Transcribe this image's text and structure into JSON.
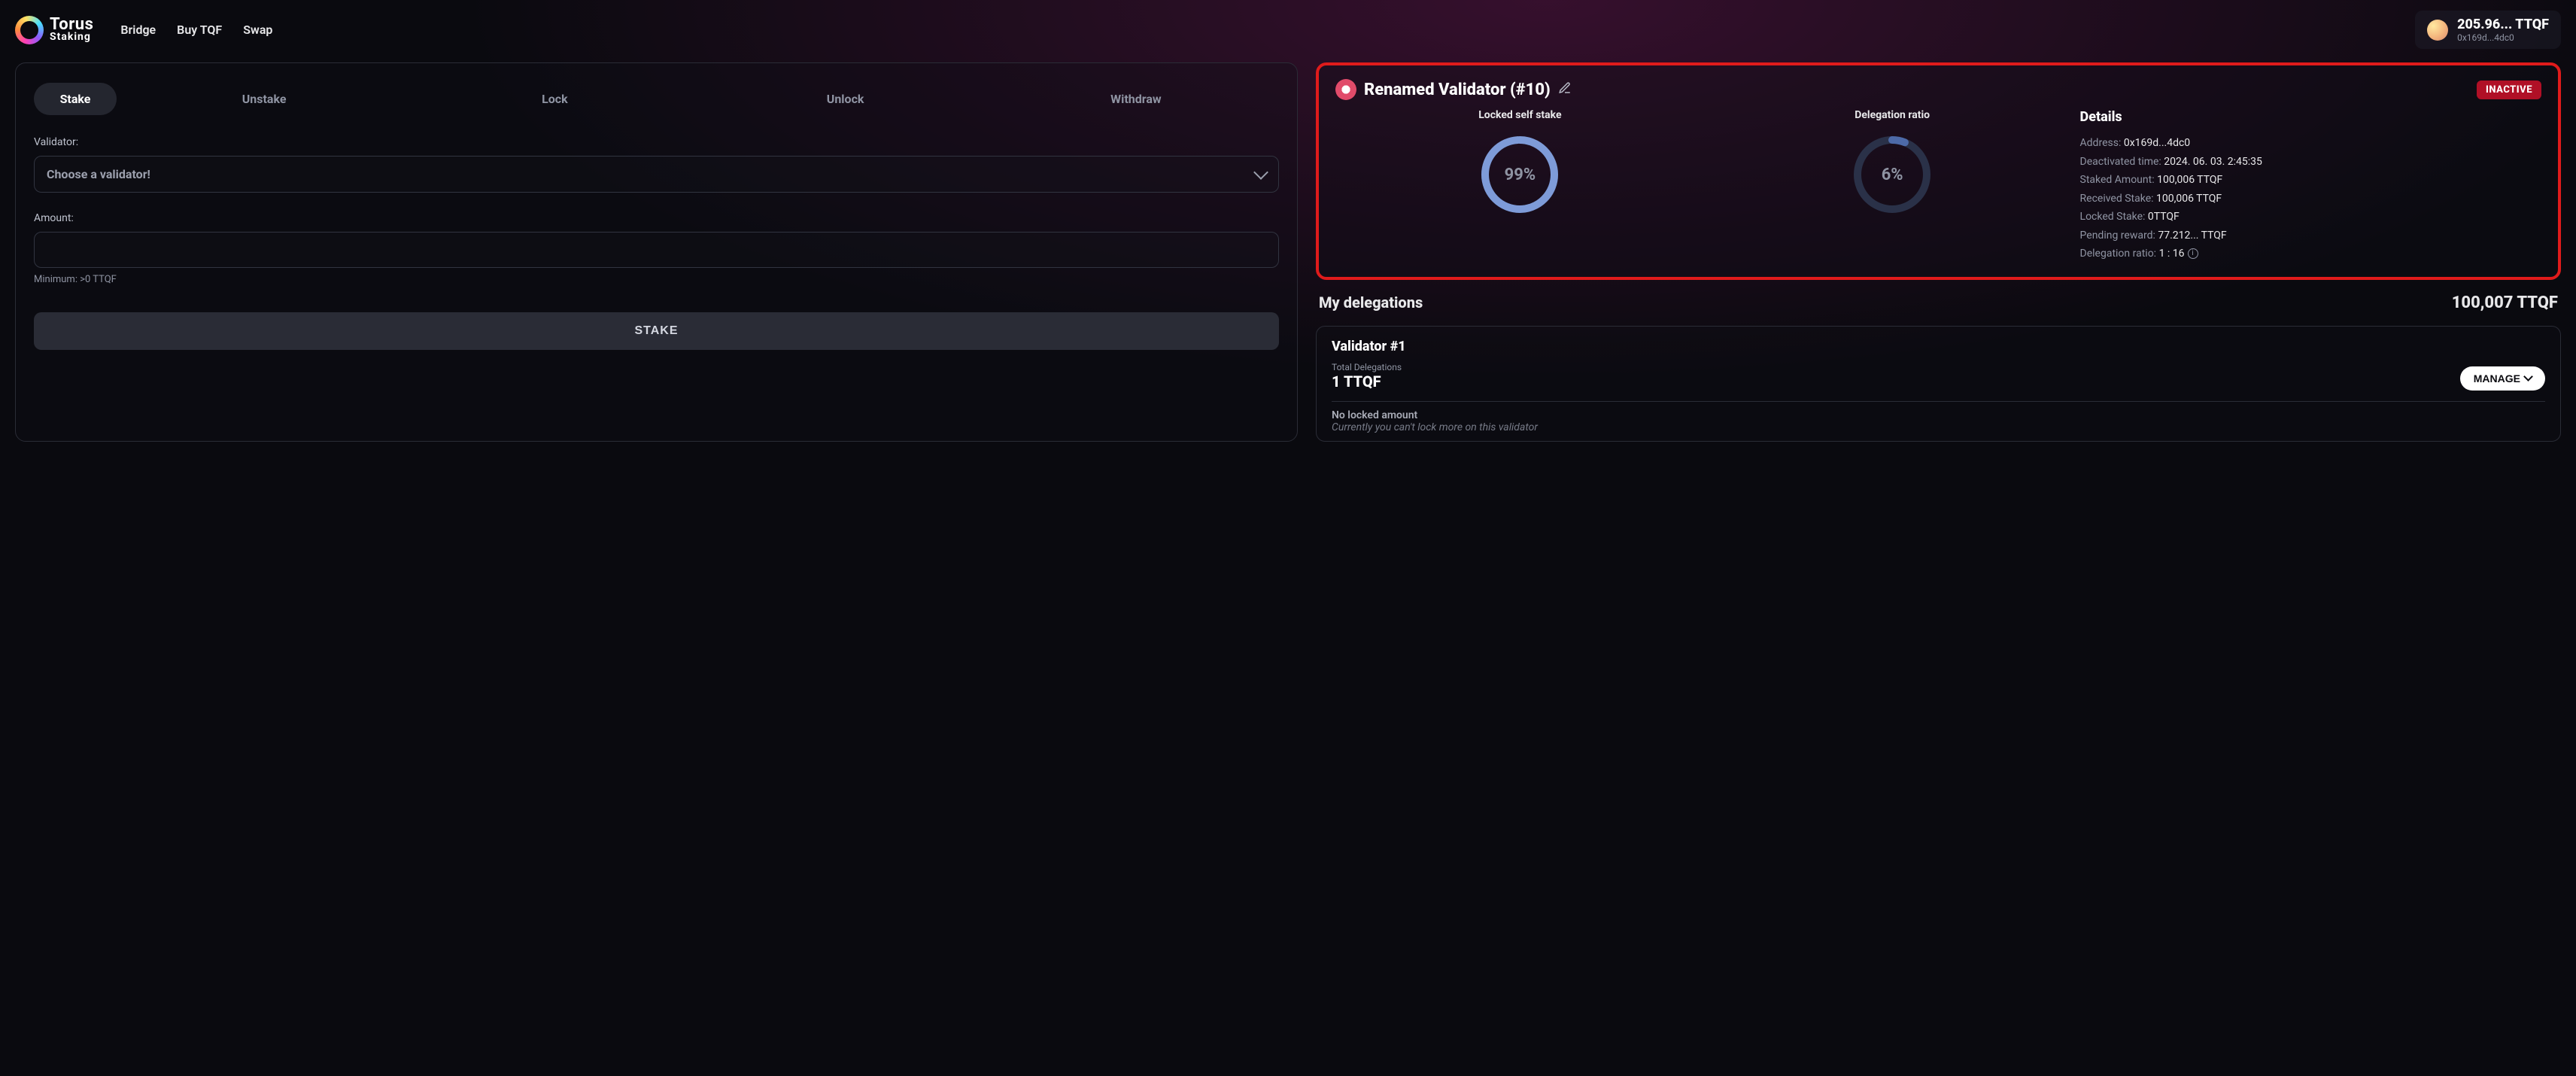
{
  "brand": {
    "line1": "Torus",
    "line2": "Staking"
  },
  "nav": {
    "bridge": "Bridge",
    "buy": "Buy TQF",
    "swap": "Swap"
  },
  "account": {
    "balance": "205.96... TTQF",
    "address": "0x169d...4dc0"
  },
  "tabs": {
    "stake": "Stake",
    "unstake": "Unstake",
    "lock": "Lock",
    "unlock": "Unlock",
    "withdraw": "Withdraw"
  },
  "stakeForm": {
    "validatorLabel": "Validator:",
    "validatorPlaceholder": "Choose a validator!",
    "amountLabel": "Amount:",
    "minHint": "Minimum: >0 TTQF",
    "submit": "STAKE"
  },
  "validator": {
    "name": "Renamed Validator (#10)",
    "statusBadge": "INACTIVE",
    "gauges": {
      "lockedSelfStake": {
        "label": "Locked self stake",
        "valueText": "99%",
        "percent": 99
      },
      "delegationRatio": {
        "label": "Delegation ratio",
        "valueText": "6%",
        "percent": 6
      }
    },
    "details": {
      "heading": "Details",
      "addressLabel": "Address:",
      "addressValue": "0x169d...4dc0",
      "deactivatedLabel": "Deactivated time:",
      "deactivatedValue": "2024. 06. 03. 2:45:35",
      "stakedLabel": "Staked Amount:",
      "stakedValue": "100,006 TTQF",
      "receivedLabel": "Received Stake:",
      "receivedValue": "100,006 TTQF",
      "lockedLabel": "Locked Stake:",
      "lockedValue": "0TTQF",
      "pendingLabel": "Pending reward:",
      "pendingValue": "77.212... TTQF",
      "ratioLabel": "Delegation ratio:",
      "ratioValue": "1 : 16"
    }
  },
  "delegations": {
    "title": "My delegations",
    "total": "100,007 TTQF",
    "card": {
      "name": "Validator #1",
      "totalLabel": "Total Delegations",
      "totalValue": "1 TTQF",
      "manage": "MANAGE",
      "noLockTitle": "No locked amount",
      "noLockSub": "Currently you can't lock more on this validator"
    }
  }
}
